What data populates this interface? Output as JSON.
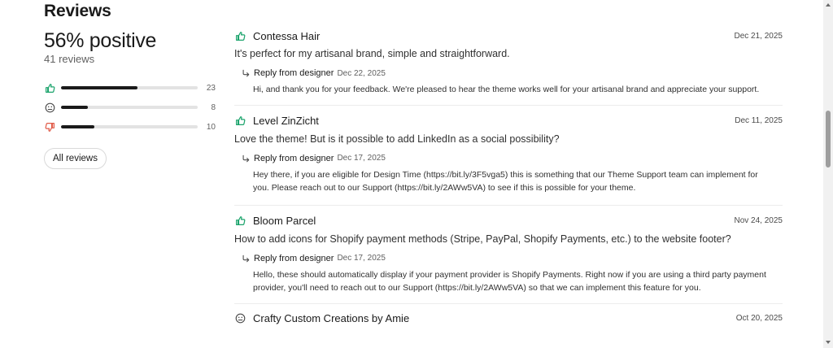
{
  "title": "Reviews",
  "summary": {
    "percent_positive": "56% positive",
    "total_reviews": "41 reviews",
    "breakdown": [
      {
        "kind": "positive",
        "icon": "thumbs-up-icon",
        "count": "23",
        "fraction": 0.56
      },
      {
        "kind": "neutral",
        "icon": "neutral-face-icon",
        "count": "8",
        "fraction": 0.195
      },
      {
        "kind": "negative",
        "icon": "thumbs-down-icon",
        "count": "10",
        "fraction": 0.244
      }
    ],
    "all_reviews_label": "All reviews"
  },
  "colors": {
    "positive": "#1aa36b",
    "negative": "#e05a47",
    "neutral": "#4a4a4a"
  },
  "reviews": [
    {
      "sentiment": "positive",
      "author": "Contessa Hair",
      "date": "Dec 21, 2025",
      "text": "It's perfect for my artisanal brand, simple and straightforward.",
      "reply": {
        "label": "Reply from designer",
        "date": "Dec 22, 2025",
        "text": "Hi, and thank you for your feedback. We're pleased to hear the theme works well for your artisanal brand and appreciate your support."
      }
    },
    {
      "sentiment": "positive",
      "author": "Level ZinZicht",
      "date": "Dec 11, 2025",
      "text": "Love the theme! But is it possible to add LinkedIn as a social possibility?",
      "reply": {
        "label": "Reply from designer",
        "date": "Dec 17, 2025",
        "text": "Hey there, if you are eligible for Design Time (https://bit.ly/3F5vga5) this is something that our Theme Support team can implement for you. Please reach out to our Support (https://bit.ly/2AWw5VA) to see if this is possible for your theme."
      }
    },
    {
      "sentiment": "positive",
      "author": "Bloom Parcel",
      "date": "Nov 24, 2025",
      "text": "How to add icons for Shopify payment methods (Stripe, PayPal, Shopify Payments, etc.) to the website footer?",
      "reply": {
        "label": "Reply from designer",
        "date": "Dec 17, 2025",
        "text": "Hello, these should automatically display if your payment provider is Shopify Payments. Right now if you are using a third party payment provider, you'll need to reach out to our Support (https://bit.ly/2AWw5VA) so that we can implement this feature for you."
      }
    },
    {
      "sentiment": "neutral",
      "author": "Crafty Custom Creations by Amie",
      "date": "Oct 20, 2025",
      "text": "",
      "reply": null
    }
  ]
}
